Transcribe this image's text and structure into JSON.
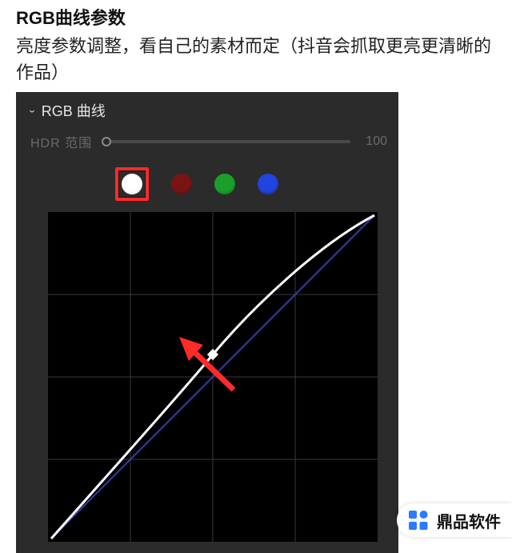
{
  "article": {
    "title": "RGB曲线参数",
    "desc": "亮度参数调整，看自己的素材而定（抖音会抓取更亮更清晰的作品）"
  },
  "panel": {
    "title": "RGB 曲线",
    "hdr_label": "HDR 范围",
    "hdr_value": "100"
  },
  "channels": {
    "white": "white-channel",
    "red": "red-channel",
    "green": "green-channel",
    "blue": "blue-channel",
    "selected": "white"
  },
  "branding": {
    "name": "鼎品软件"
  },
  "chart_data": {
    "type": "line",
    "title": "RGB 曲线",
    "xlabel": "",
    "ylabel": "",
    "xlim": [
      0,
      255
    ],
    "ylim": [
      0,
      255
    ],
    "grid": true,
    "series": [
      {
        "name": "baseline",
        "color": "#3a3aa8",
        "x": [
          0,
          255
        ],
        "y": [
          0,
          255
        ]
      },
      {
        "name": "luminance-curve",
        "color": "#ffffff",
        "x": [
          0,
          32,
          64,
          96,
          128,
          160,
          192,
          224,
          255
        ],
        "y": [
          0,
          50,
          92,
          128,
          160,
          188,
          214,
          236,
          255
        ]
      }
    ],
    "control_point": {
      "x": 128,
      "y": 160
    },
    "annotations": [
      {
        "type": "arrow",
        "from": [
          150,
          128
        ],
        "to": [
          108,
          170
        ],
        "color": "#ff2a2a"
      }
    ]
  }
}
